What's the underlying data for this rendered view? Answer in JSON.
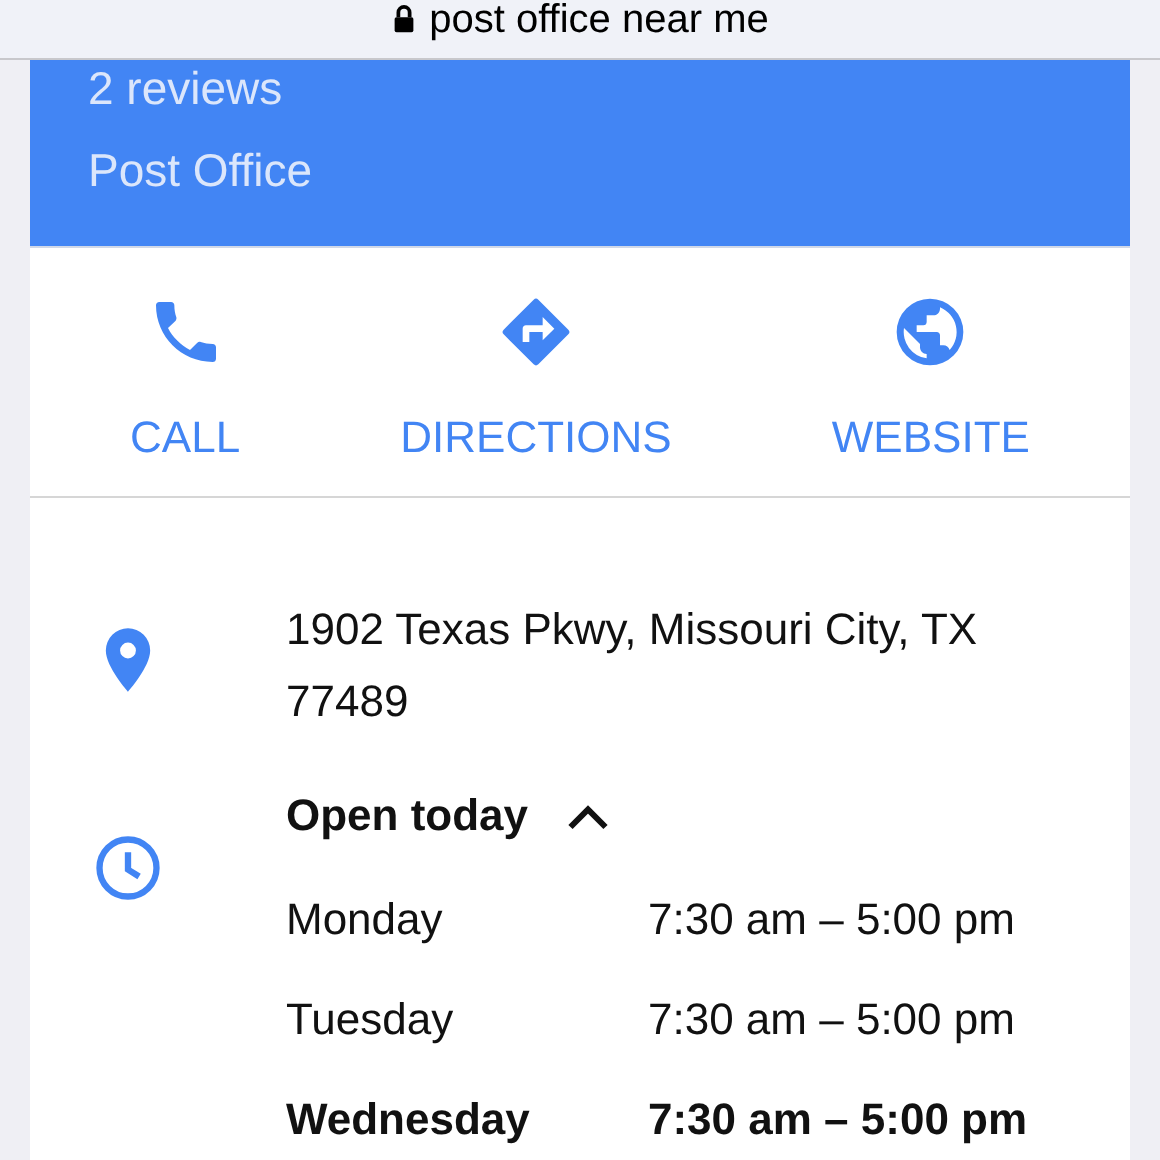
{
  "address_bar": {
    "text": "post office near me",
    "secure": true
  },
  "header": {
    "reviews": "2 reviews",
    "category": "Post Office"
  },
  "actions": [
    {
      "kind": "call",
      "label": "CALL"
    },
    {
      "kind": "directions",
      "label": "DIRECTIONS"
    },
    {
      "kind": "website",
      "label": "WEBSITE"
    }
  ],
  "address": "1902 Texas Pkwy, Missouri City, TX 77489",
  "hours": {
    "status": "Open today",
    "expanded": true,
    "days": [
      {
        "day": "Monday",
        "time": "7:30 am – 5:00 pm",
        "today": false
      },
      {
        "day": "Tuesday",
        "time": "7:30 am – 5:00 pm",
        "today": false
      },
      {
        "day": "Wednesday",
        "time": "7:30 am – 5:00 pm",
        "today": true
      }
    ]
  }
}
